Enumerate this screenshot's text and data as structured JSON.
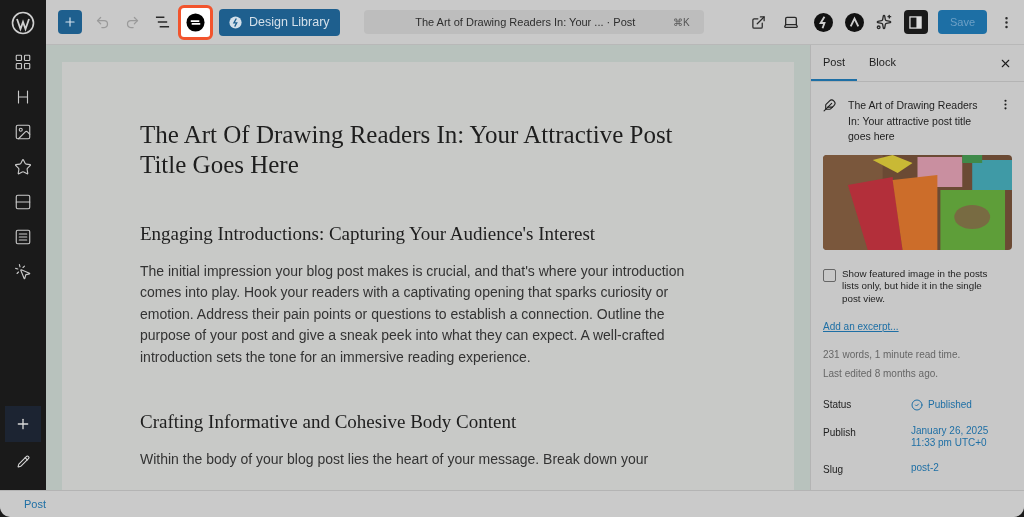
{
  "toolbar": {
    "design_library": "Design Library",
    "command": {
      "title": "The Art of Drawing Readers In: Your ...",
      "suffix": "· Post",
      "shortcut": "⌘K"
    },
    "highlighted_tool": true,
    "settings_open": true,
    "save": "Save",
    "save_disabled": true
  },
  "document": {
    "title": "The Art Of Drawing Readers In: Your Attractive Post Title Goes Here",
    "blocks": [
      {
        "kind": "heading",
        "text": "Engaging Introductions: Capturing Your Audience's Interest"
      },
      {
        "kind": "paragraph",
        "text": "The initial impression your blog post makes is crucial, and that's where your introduction comes into play. Hook your readers with a captivating opening that sparks curiosity or emotion. Address their pain points or questions to establish a connection. Outline the purpose of your post and give a sneak peek into what they can expect. A well-crafted introduction sets the tone for an immersive reading experience."
      },
      {
        "kind": "heading",
        "text": "Crafting Informative and Cohesive Body Content"
      },
      {
        "kind": "paragraph",
        "text": "Within the body of your blog post lies the heart of your message. Break down your"
      }
    ]
  },
  "sidebar": {
    "tabs": [
      {
        "label": "Post",
        "selected": true
      },
      {
        "label": "Block",
        "selected": false
      }
    ],
    "post_title": "The Art of Drawing Readers In: Your attractive post title goes here",
    "featured_image": {
      "kind": "picture"
    },
    "checkbox": {
      "label": "Show featured image in the posts lists only, but hide it in the single post view.",
      "checked": false
    },
    "excerpt_link": "Add an excerpt...",
    "stats": [
      "231 words, 1 minute read time.",
      "Last edited 8 months ago."
    ],
    "fields": [
      {
        "label": "Status",
        "value": [
          "Published"
        ],
        "kind": "status"
      },
      {
        "label": "Publish",
        "value": [
          "January 26, 2025",
          "11:33 pm UTC+0"
        ],
        "kind": "link"
      },
      {
        "label": "Slug",
        "value": [
          "post-2"
        ],
        "kind": "link"
      }
    ]
  },
  "footer": {
    "breadcrumb": "Post"
  }
}
